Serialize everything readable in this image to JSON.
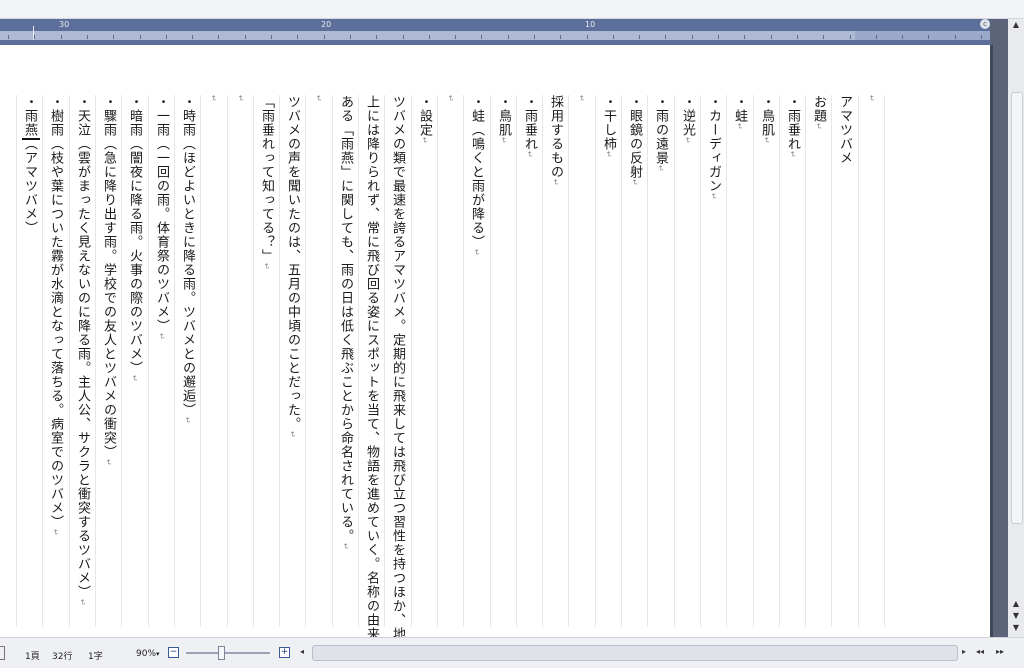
{
  "ruler": {
    "numbers": [
      "30",
      "20",
      "10"
    ],
    "corner": "c"
  },
  "columns": [
    {
      "text": "",
      "mark": "↵"
    },
    {
      "text": "アマツバメ",
      "mark": ""
    },
    {
      "text": "お題",
      "mark": "↵"
    },
    {
      "text": "・雨垂れ",
      "mark": "↵"
    },
    {
      "text": "・鳥肌",
      "mark": "↵"
    },
    {
      "text": "・蛙",
      "mark": "↵"
    },
    {
      "text": "・カーディガン",
      "mark": "↵"
    },
    {
      "text": "・逆光",
      "mark": "↵"
    },
    {
      "text": "・雨の遠景",
      "mark": "↵"
    },
    {
      "text": "・眼鏡の反射",
      "mark": "↵"
    },
    {
      "text": "・干し柿",
      "mark": "↵"
    },
    {
      "text": "",
      "mark": "↵"
    },
    {
      "text": "採用するもの",
      "mark": "↵"
    },
    {
      "text": "・雨垂れ",
      "mark": "↵"
    },
    {
      "text": "・鳥肌",
      "mark": "↵"
    },
    {
      "text": "・蛙（鳴くと雨が降る）",
      "mark": "↵"
    },
    {
      "text": "",
      "mark": "↵"
    },
    {
      "text": "・設定",
      "mark": "↵"
    },
    {
      "text": "ツバメの類で最速を誇るアマツバメ。定期的に飛来しては飛び立つ習性を持つほか、地",
      "mark": ""
    },
    {
      "text": "上には降りられず、常に飛び回る姿にスポットを当て、物語を進めていく。名称の由来で",
      "mark": ""
    },
    {
      "text": "ある「雨燕」に関しても、雨の日は低く飛ぶことから命名されている。",
      "mark": "↵"
    },
    {
      "text": "",
      "mark": "↵"
    },
    {
      "text": "ツバメの声を聞いたのは、五月の中頃のことだった。",
      "mark": "↵"
    },
    {
      "text": "「雨垂れって知ってる？」",
      "mark": "↵"
    },
    {
      "text": "",
      "mark": "↵"
    },
    {
      "text": "",
      "mark": "↵"
    },
    {
      "text": "・時雨（ほどよいときに降る雨。ツバメとの邂逅）",
      "mark": "↵"
    },
    {
      "text": "・一雨（一回の雨。体育祭のツバメ）",
      "mark": "↵"
    },
    {
      "text": "・暗雨（闇夜に降る雨。火事の際のツバメ）",
      "mark": "↵"
    },
    {
      "text": "・驟雨（急に降り出す雨。学校での友人とツバメの衝突）",
      "mark": "↵"
    },
    {
      "text": "・天泣（雲がまったく見えないのに降る雨。主人公、サクラと衝突するツバメ）",
      "mark": "↵"
    },
    {
      "text": "・樹雨（枝や葉についた霧が水滴となって落ちる。病室でのツバメ）",
      "mark": "↵"
    },
    {
      "text": "・雨燕（アマツバメ）",
      "mark": ""
    }
  ],
  "status": {
    "page": "1頁",
    "line": "32行",
    "char": "1字",
    "zoom": "90%",
    "zoom_caret": "▾",
    "zoom_minus": "−",
    "zoom_plus": "+"
  },
  "icons": {
    "scroll_up": "▲",
    "scroll_down": "▼",
    "nav_prev": "◂◂",
    "nav_next": "▸▸",
    "page_left": "◂",
    "page_right": "▸"
  }
}
